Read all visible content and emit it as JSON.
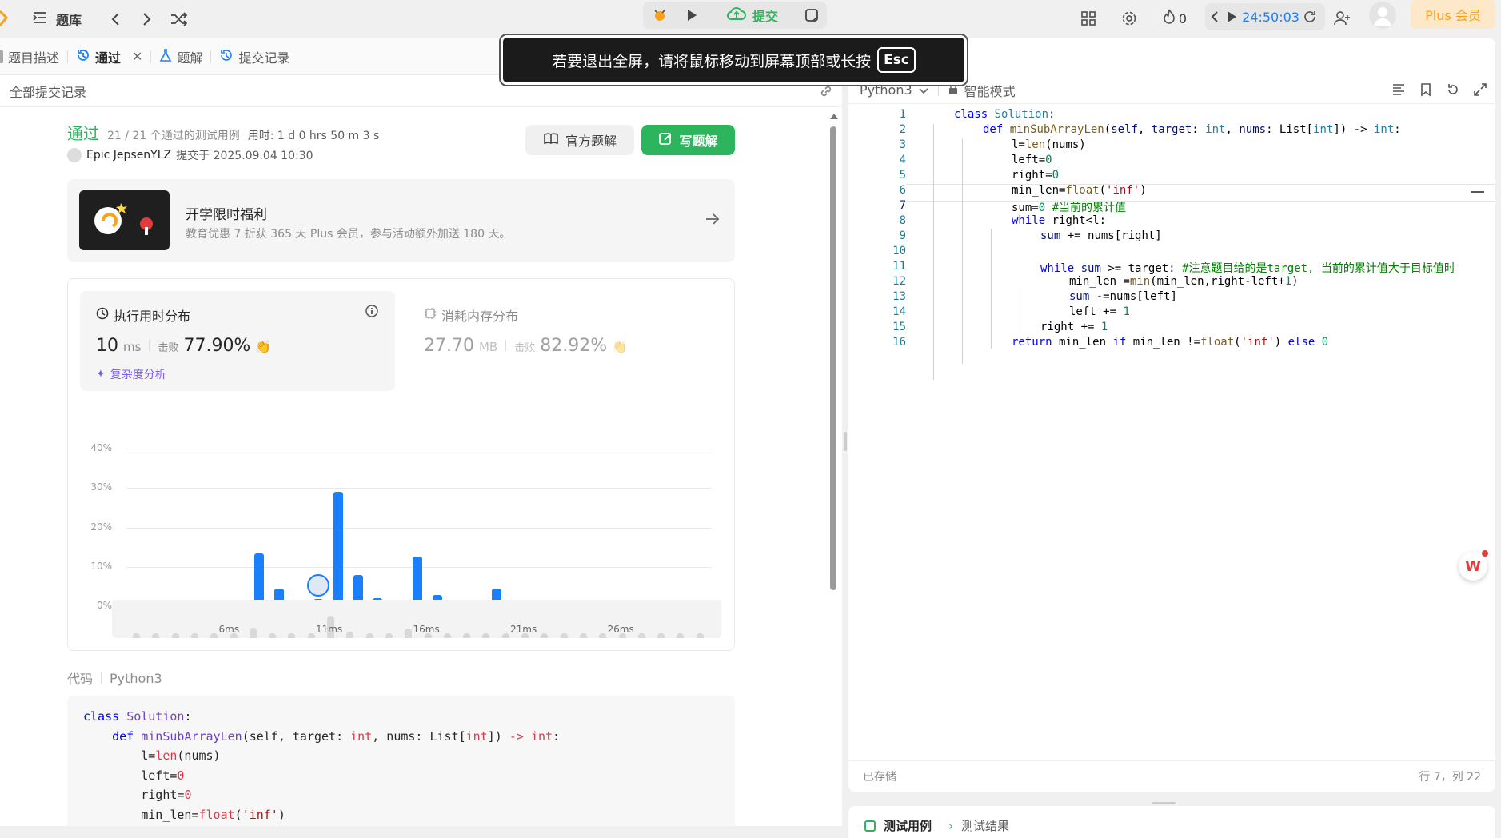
{
  "topbar": {
    "problem_bank": "题库",
    "submit": "提交",
    "streak": "0",
    "timer": "24:50:03",
    "plus": "Plus 会员"
  },
  "left": {
    "tabs": [
      "题目描述",
      "通过",
      "题解",
      "提交记录"
    ],
    "all_submissions": "全部提交记录",
    "status": "通过",
    "cases": "21 / 21 个通过的测试用例",
    "used_time": "用时: 1 d 0 hrs 50 m 3 s",
    "user": "Epic JepsenYLZ",
    "submitted_at": "提交于 2025.09.04 10:30",
    "official_solution": "官方题解",
    "write_solution": "写题解",
    "promo_title": "开学限时福利",
    "promo_desc": "教育优惠 7 折获 365 天 Plus 会员，参与活动额外加送 180 天。",
    "runtime_title": "执行用时分布",
    "runtime_value": "10",
    "runtime_unit": "ms",
    "beat_label": "击败",
    "runtime_beat": "77.90%",
    "complexity": "复杂度分析",
    "memory_title": "消耗内存分布",
    "memory_value": "27.70",
    "memory_unit": "MB",
    "memory_beat": "82.92%",
    "code_label": "代码",
    "code_lang": "Python3"
  },
  "chart_data": {
    "type": "bar",
    "ylim": [
      0,
      40
    ],
    "yticks": [
      "40%",
      "30%",
      "20%",
      "10%",
      "0%"
    ],
    "xticks": [
      "6ms",
      "11ms",
      "16ms",
      "21ms",
      "26ms"
    ],
    "x": [
      1,
      2,
      3,
      4,
      5,
      6,
      7,
      8,
      9,
      10,
      11,
      12,
      13,
      14,
      15,
      16,
      17,
      18,
      19,
      20,
      21,
      22,
      23,
      24,
      25,
      26,
      27,
      28,
      29,
      30
    ],
    "values": [
      1,
      1,
      1,
      1,
      1,
      1,
      13.5,
      4.5,
      1.5,
      1.8,
      29,
      8,
      2,
      1.3,
      12.5,
      2.8,
      1,
      1,
      4.5,
      1,
      1,
      1,
      1.3,
      1,
      1,
      1,
      1,
      1,
      1,
      1
    ],
    "highlight_x": 10,
    "color": "#1a7ffa"
  },
  "left_code": [
    "class Solution:",
    "    def minSubArrayLen(self, target: int, nums: List[int]) -> int:",
    "        l=len(nums)",
    "        left=0",
    "        right=0",
    "        min_len=float('inf')"
  ],
  "editor": {
    "lang": "Python3",
    "mode": "智能模式",
    "saved": "已存储",
    "cursor": "行 7，列 22",
    "bottom_tab1": "测试用例",
    "bottom_tab2": "测试结果"
  },
  "fullscreen_toast": {
    "text": "若要退出全屏，请将鼠标移动到屏幕顶部或长按",
    "key": "Esc"
  }
}
